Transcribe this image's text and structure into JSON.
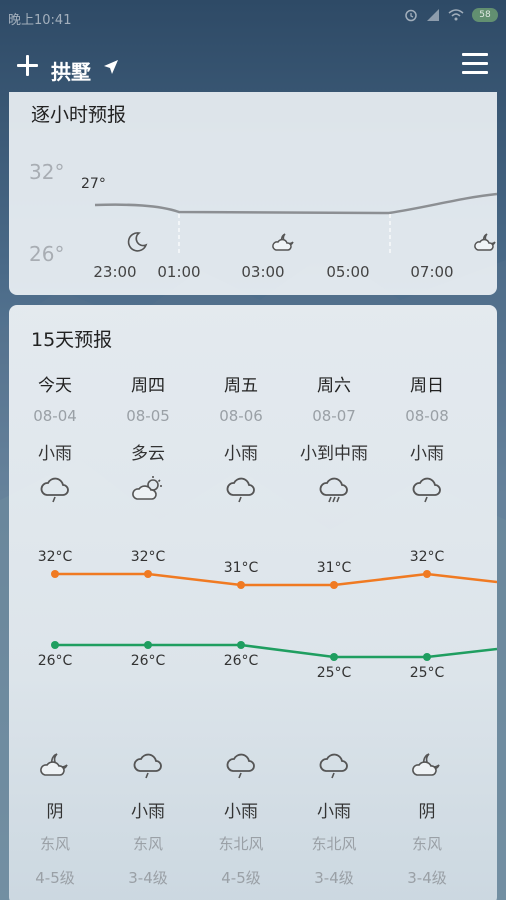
{
  "status_bar": {
    "time": "晚上10:41",
    "battery": "58"
  },
  "header": {
    "city": "拱墅"
  },
  "hourly": {
    "title": "逐小时预报",
    "axis_high": "32°",
    "axis_low": "26°",
    "current_temp": "27°",
    "hours": [
      "23:00",
      "01:00",
      "03:00",
      "05:00",
      "07:00"
    ],
    "icons": [
      "moon-icon",
      "cloudy-night-icon",
      "cloudy-night-icon"
    ]
  },
  "daily": {
    "title": "15天预报",
    "days": [
      {
        "name": "今天",
        "date": "08-04",
        "weather": "小雨",
        "day_icon": "light-rain-icon",
        "high": "32°C",
        "low": "26°C",
        "night_icon": "cloudy-night-icon",
        "night_weather": "阴",
        "wind": "东风",
        "level": "4-5级"
      },
      {
        "name": "周四",
        "date": "08-05",
        "weather": "多云",
        "day_icon": "partly-cloudy-icon",
        "high": "32°C",
        "low": "26°C",
        "night_icon": "light-rain-icon",
        "night_weather": "小雨",
        "wind": "东风",
        "level": "3-4级"
      },
      {
        "name": "周五",
        "date": "08-06",
        "weather": "小雨",
        "day_icon": "light-rain-icon",
        "high": "31°C",
        "low": "26°C",
        "night_icon": "light-rain-icon",
        "night_weather": "小雨",
        "wind": "东北风",
        "level": "4-5级"
      },
      {
        "name": "周六",
        "date": "08-07",
        "weather": "小到中雨",
        "day_icon": "moderate-rain-icon",
        "high": "31°C",
        "low": "25°C",
        "night_icon": "light-rain-icon",
        "night_weather": "小雨",
        "wind": "东北风",
        "level": "3-4级"
      },
      {
        "name": "周日",
        "date": "08-08",
        "weather": "小雨",
        "day_icon": "light-rain-icon",
        "high": "32°C",
        "low": "25°C",
        "night_icon": "cloudy-night-icon",
        "night_weather": "阴",
        "wind": "东风",
        "level": "3-4级"
      }
    ],
    "high_color": "#f07a22",
    "low_color": "#1f9e60"
  }
}
